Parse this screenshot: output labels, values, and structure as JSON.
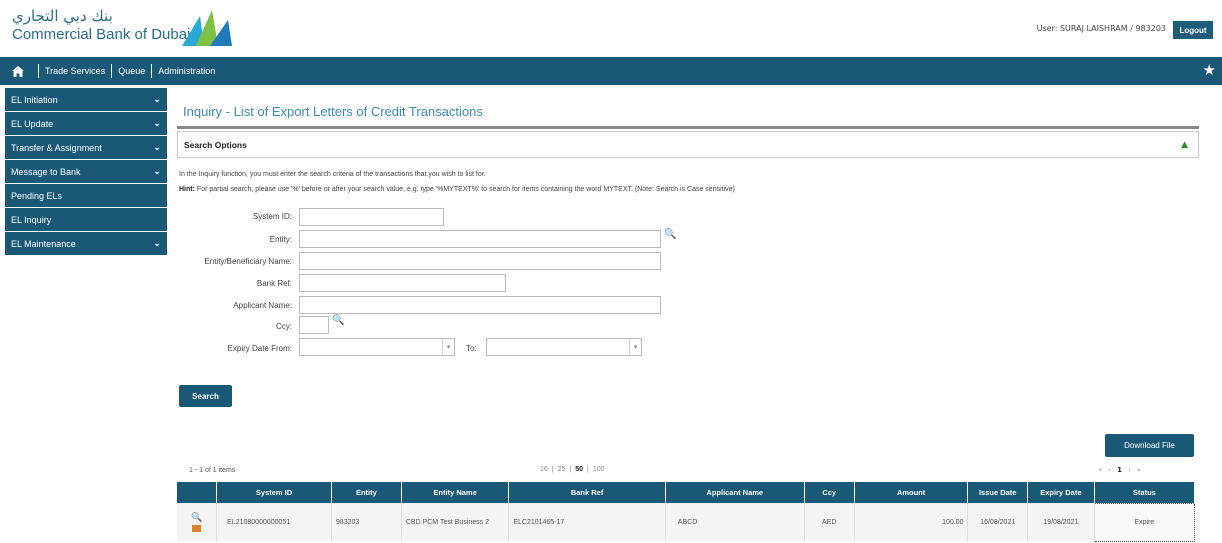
{
  "header": {
    "logo_arabic": "بنك دبي التجاري",
    "logo_english": "Commercial Bank of Dubai",
    "user_label": "User:",
    "user_value": "SURAJ LAISHRAM / 983203",
    "logout_label": "Logout"
  },
  "nav": {
    "items": [
      "Trade Services",
      "Queue",
      "Administration"
    ]
  },
  "sidebar": {
    "items": [
      {
        "label": "EL Initiation",
        "chevron": true
      },
      {
        "label": "EL Update",
        "chevron": true
      },
      {
        "label": "Transfer & Assignment",
        "chevron": true
      },
      {
        "label": "Message to Bank",
        "chevron": true
      },
      {
        "label": "Pending ELs",
        "chevron": false
      },
      {
        "label": "EL Inquiry",
        "chevron": false
      },
      {
        "label": "EL Maintenance",
        "chevron": true
      }
    ]
  },
  "main": {
    "title": "Inquiry - List of Export Letters of Credit Transactions",
    "search_options_label": "Search Options",
    "intro": "In the Inquiry function, you must enter the search criteria of the transactions that you wish to list for.",
    "hint_label": "Hint:",
    "hint": "For partial search, please use '%' before or after your search value, e.g. type '%MYTEXT%' to search for items containing the word MYTEXT. (Note: Search is Case sensitive)",
    "fields": {
      "system_id": "System ID:",
      "entity": "Entity:",
      "beneficiary": "Entity/Beneficiary Name:",
      "bank_ref": "Bank Ref:",
      "applicant": "Applicant Name:",
      "ccy": "Ccy:",
      "expiry_from": "Expiry Date From:",
      "to": "To:"
    },
    "search_button": "Search",
    "download_button": "Download File",
    "items_count": "1 - 1 of 1 items",
    "page_sizes": [
      "10",
      "25",
      "50",
      "100"
    ],
    "page_size_selected": "50",
    "pager": {
      "first": "«",
      "prev": "‹",
      "current": "1",
      "next": "›",
      "last": "»"
    }
  },
  "table": {
    "columns": [
      "System ID",
      "Entity",
      "Entity Name",
      "Bank Ref",
      "Applicant Name",
      "Ccy",
      "Amount",
      "Issue Date",
      "Expiry Date",
      "Status"
    ],
    "rows": [
      {
        "system_id": "EL21080000000051",
        "entity": "983203",
        "entity_name": "CBD PCM Test Business 2",
        "bank_ref": "ELC2101465-17",
        "applicant": "ABCD",
        "ccy": "AED",
        "amount": "100.00",
        "issue_date": "16/08/2021",
        "expiry_date": "19/08/2021",
        "status": "Expire"
      }
    ]
  },
  "colors": {
    "primary": "#1a5878",
    "title": "#3b8ab8",
    "accent_green": "#2e8b2e"
  },
  "icons": {
    "home": "home-icon",
    "star": "star-icon",
    "lookup": "magnifier-icon",
    "view": "view-icon",
    "folder": "folder-icon"
  }
}
